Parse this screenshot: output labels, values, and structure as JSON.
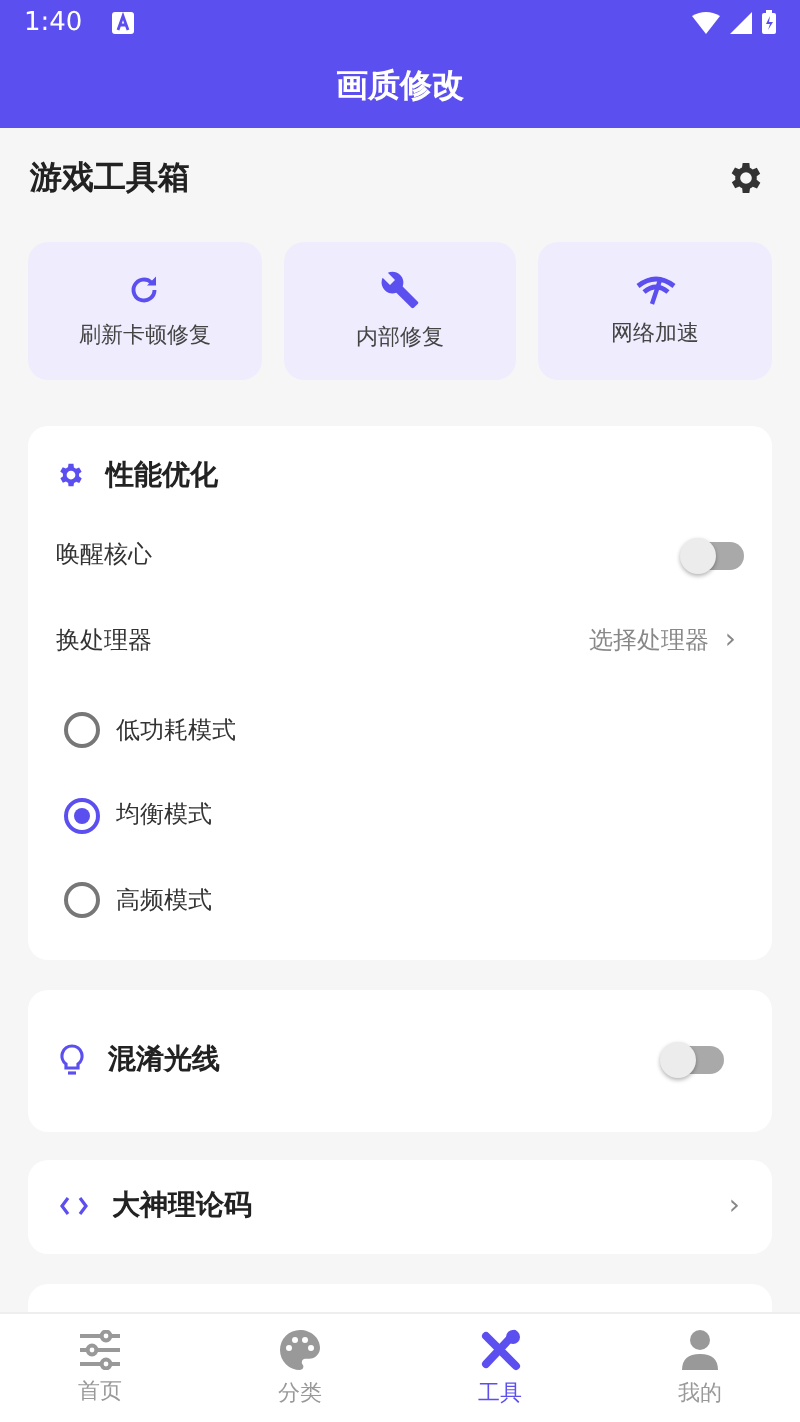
{
  "status_bar": {
    "time": "1:40"
  },
  "app_bar": {
    "title": "画质修改"
  },
  "section": {
    "title": "游戏工具箱"
  },
  "tools": [
    {
      "kind": "refresh",
      "label": "刷新卡顿修复"
    },
    {
      "kind": "wrench",
      "label": "内部修复"
    },
    {
      "kind": "network",
      "label": "网络加速"
    }
  ],
  "performance": {
    "title": "性能优化",
    "toggle": {
      "label": "唤醒核心",
      "on": false
    },
    "processor": {
      "label": "换处理器",
      "value": "选择处理器",
      "chevron": "›"
    },
    "modes": [
      {
        "label": "低功耗模式",
        "selected": false
      },
      {
        "label": "均衡模式",
        "selected": true
      },
      {
        "label": "高频模式",
        "selected": false
      }
    ]
  },
  "light": {
    "label": "混淆光线",
    "on": false
  },
  "code": {
    "label": "大神理论码",
    "chevron": "›"
  },
  "nav": [
    {
      "kind": "sliders",
      "label": "首页",
      "selected": false
    },
    {
      "kind": "palette",
      "label": "分类",
      "selected": false
    },
    {
      "kind": "tools",
      "label": "工具",
      "selected": true
    },
    {
      "kind": "person",
      "label": "我的",
      "selected": false
    }
  ]
}
